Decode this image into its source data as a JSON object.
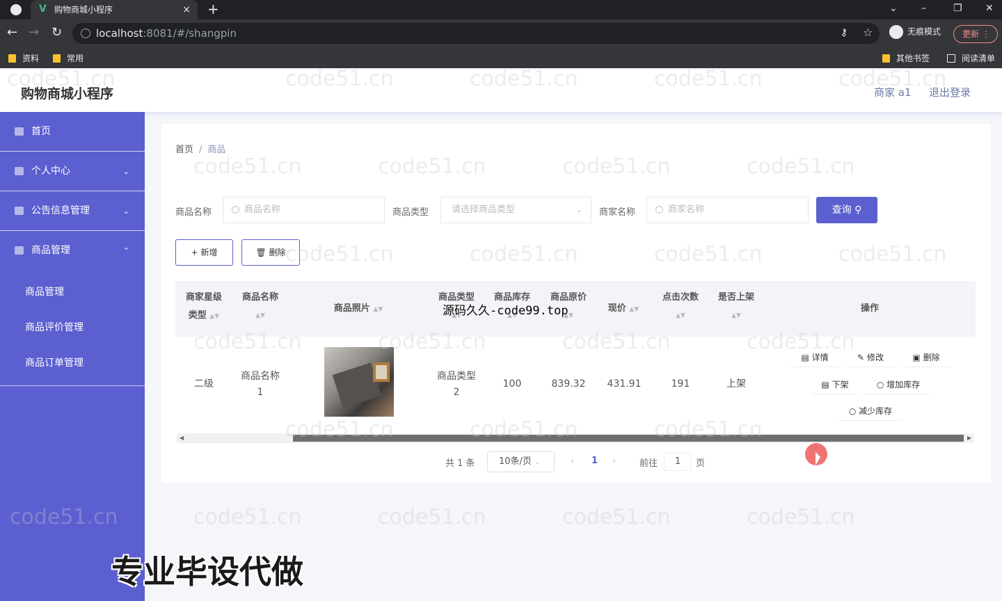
{
  "browser": {
    "tab_title": "购物商城小程序",
    "url_host": "localhost",
    "url_rest": ":8081/#/shangpin",
    "incognito_label": "无痕模式",
    "update_label": "更新",
    "bookmarks": [
      "资料",
      "常用"
    ],
    "bookmarks_right": [
      "其他书签",
      "阅读清单"
    ]
  },
  "header": {
    "title": "购物商城小程序",
    "user": "商家 a1",
    "logout": "退出登录"
  },
  "sidebar": {
    "items": [
      {
        "label": "首页"
      },
      {
        "label": "个人中心"
      },
      {
        "label": "公告信息管理"
      },
      {
        "label": "商品管理"
      }
    ],
    "sub_items": [
      "商品管理",
      "商品评价管理",
      "商品订单管理"
    ]
  },
  "breadcrumb": {
    "home": "首页",
    "current": "商品"
  },
  "search": {
    "name_label": "商品名称",
    "name_placeholder": "商品名称",
    "type_label": "商品类型",
    "type_placeholder": "请选择商品类型",
    "merchant_label": "商家名称",
    "merchant_placeholder": "商家名称",
    "query_button": "查询"
  },
  "actions": {
    "add": "新增",
    "delete": "删除"
  },
  "table": {
    "headers": {
      "level_line1": "商家星级",
      "level_line2": "类型",
      "name": "商品名称",
      "photo": "商品照片",
      "type": "商品类型",
      "stock": "商品库存",
      "original_price": "商品原价",
      "price": "现价",
      "clicks": "点击次数",
      "on_shelf": "是否上架",
      "ops": "操作"
    },
    "rows": [
      {
        "level": "二级",
        "name_line1": "商品名称",
        "name_line2": "1",
        "type_line1": "商品类型",
        "type_line2": "2",
        "stock": "100",
        "original_price": "839.32",
        "price": "431.91",
        "clicks": "191",
        "on_shelf": "上架",
        "ops": [
          "详情",
          "修改",
          "删除",
          "下架",
          "增加库存",
          "减少库存"
        ]
      }
    ]
  },
  "pagination": {
    "total": "共 1 条",
    "page_size": "10条/页",
    "current_page": "1",
    "goto": "前往",
    "goto_value": "1",
    "page_suffix": "页"
  },
  "overlays": {
    "watermark": "code51.cn",
    "source_text": "源码久久-code99.top",
    "promo": "专业毕设代做"
  }
}
